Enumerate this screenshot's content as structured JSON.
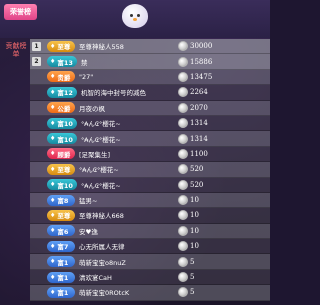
{
  "header": {
    "tab_label": "荣誉榜"
  },
  "sidebar": {
    "label": "贡献榜单"
  },
  "colors": {
    "gold": "#e2a21c",
    "silver": "#8a8f98",
    "pink": "#ff8c2a",
    "green": "#1fa5b8",
    "blue": "#3f7fe0",
    "purple": "#ff3b6b"
  },
  "rows": [
    {
      "rank": "1",
      "badge": "至尊",
      "badge_color": "gold",
      "name": "至尊神秘人558",
      "score": "30000"
    },
    {
      "rank": "2",
      "badge": "富13",
      "badge_color": "green",
      "name": "禁",
      "score": "15886"
    },
    {
      "rank": "",
      "badge": "贵爵",
      "badge_color": "pink",
      "name": "\"27\"",
      "score": "13475"
    },
    {
      "rank": "",
      "badge": "富12",
      "badge_color": "green",
      "name": "机智的海中封号的减色",
      "score": "2264"
    },
    {
      "rank": "",
      "badge": "公爵",
      "badge_color": "pink",
      "name": "月夜の枫",
      "score": "2070"
    },
    {
      "rank": "",
      "badge": "富10",
      "badge_color": "green",
      "name": "°₳ん₢°櫻花~",
      "score": "1314"
    },
    {
      "rank": "",
      "badge": "富10",
      "badge_color": "green",
      "name": "°₳ん₢°櫻花~",
      "score": "1314"
    },
    {
      "rank": "",
      "badge": "顾爵",
      "badge_color": "purple",
      "name": "[足聚集生]",
      "score": "1100"
    },
    {
      "rank": "",
      "badge": "至尊",
      "badge_color": "gold",
      "name": "°₳ん₢°櫻花~",
      "score": "520"
    },
    {
      "rank": "",
      "badge": "富10",
      "badge_color": "green",
      "name": "°₳ん₢°櫻花~",
      "score": "520"
    },
    {
      "rank": "",
      "badge": "富8",
      "badge_color": "blue",
      "name": "猛男~",
      "score": "10"
    },
    {
      "rank": "",
      "badge": "至尊",
      "badge_color": "gold",
      "name": "至尊神秘人668",
      "score": "10"
    },
    {
      "rank": "",
      "badge": "富6",
      "badge_color": "blue",
      "name": "安♥逸",
      "score": "10"
    },
    {
      "rank": "",
      "badge": "富7",
      "badge_color": "blue",
      "name": "心无所属人无律",
      "score": "10"
    },
    {
      "rank": "",
      "badge": "富1",
      "badge_color": "blue",
      "name": "萌新宝宝o8nuZ",
      "score": "5"
    },
    {
      "rank": "",
      "badge": "富1",
      "badge_color": "blue",
      "name": "清欢宴CaH",
      "score": "5"
    },
    {
      "rank": "",
      "badge": "富1",
      "badge_color": "blue",
      "name": "萌新宝宝0ROtcK",
      "score": "5"
    }
  ]
}
